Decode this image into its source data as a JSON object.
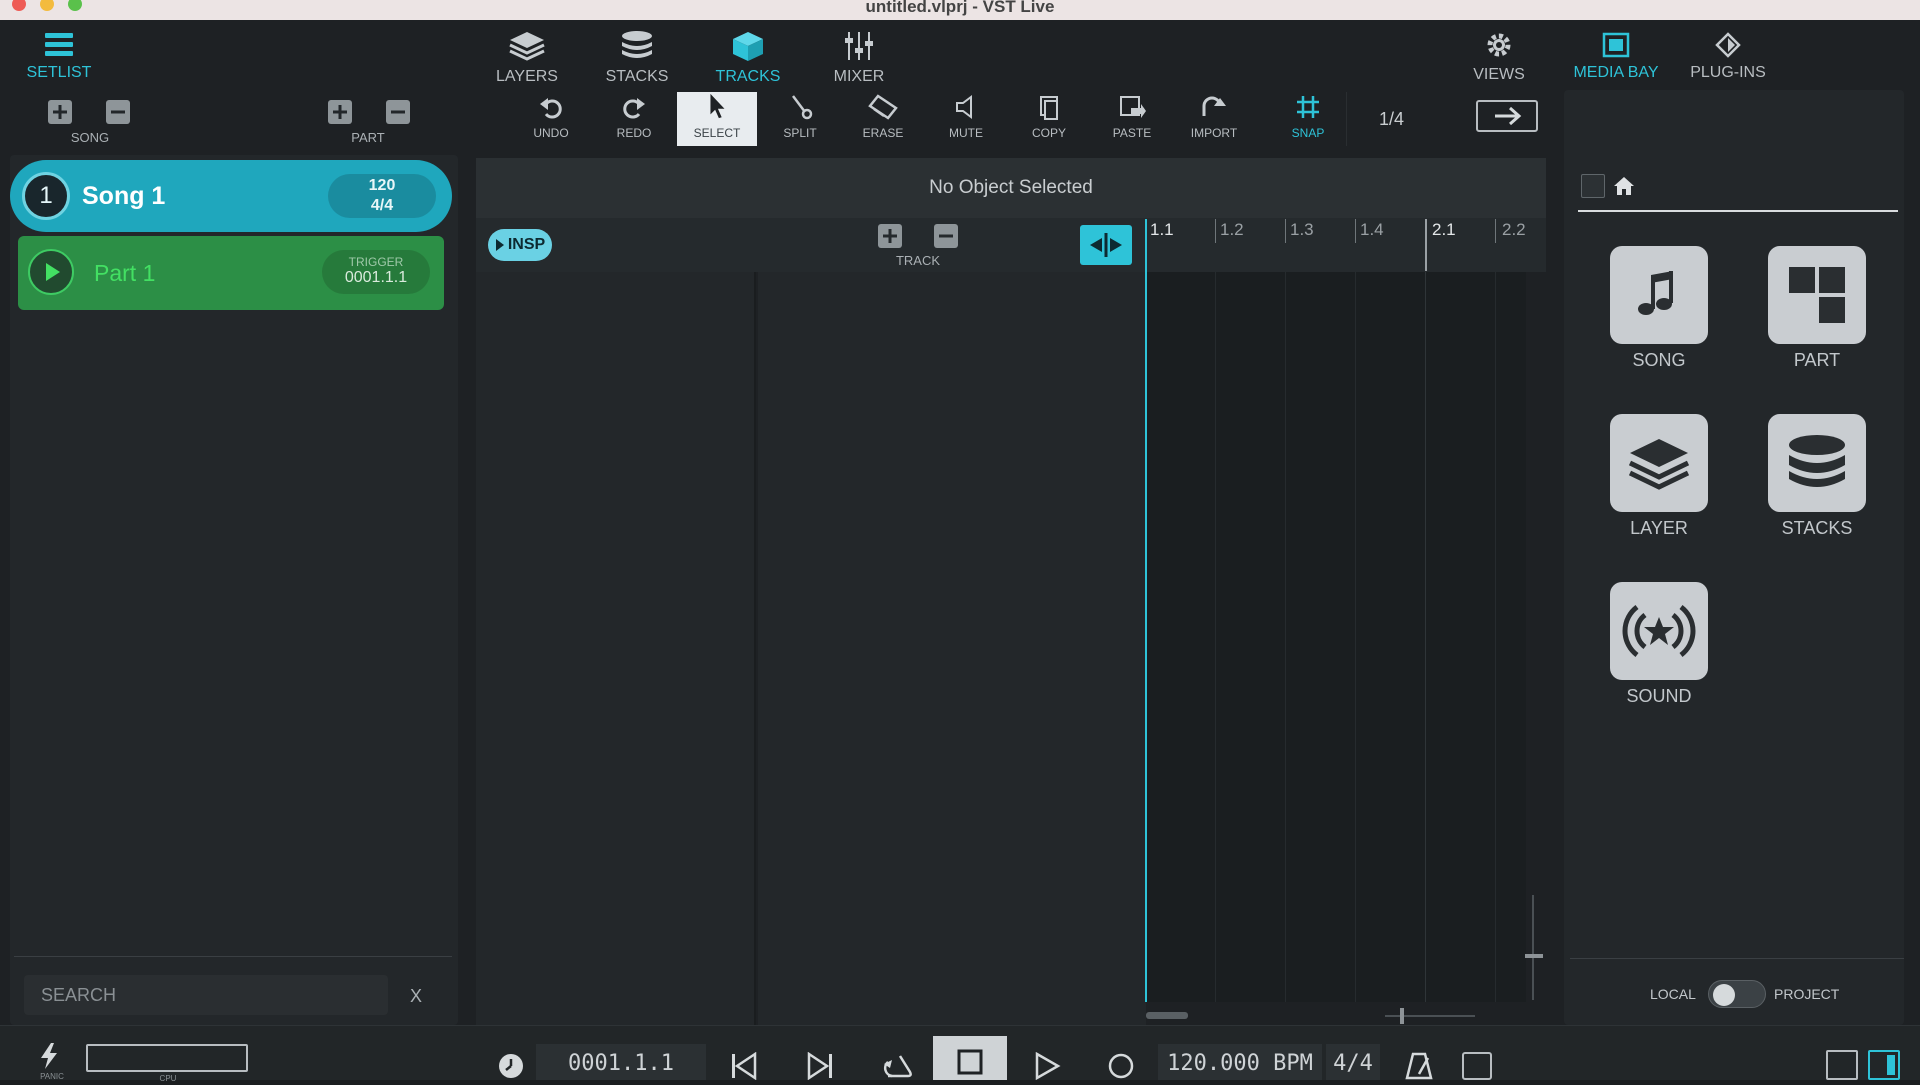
{
  "window": {
    "title": "untitled.vlprj - VST Live"
  },
  "left": {
    "setlist_label": "SETLIST",
    "song_label": "SONG",
    "part_label": "PART",
    "song": {
      "number": "1",
      "name": "Song 1",
      "tempo": "120",
      "signature": "4/4"
    },
    "part": {
      "name": "Part 1",
      "trigger_label": "TRIGGER",
      "trigger_value": "0001.1.1"
    },
    "search_placeholder": "SEARCH",
    "search_clear": "X"
  },
  "nav": {
    "layers": "LAYERS",
    "stacks": "STACKS",
    "tracks": "TRACKS",
    "mixer": "MIXER",
    "views": "VIEWS"
  },
  "tools": {
    "undo": "UNDO",
    "redo": "REDO",
    "select": "SELECT",
    "split": "SPLIT",
    "erase": "ERASE",
    "mute": "MUTE",
    "copy": "COPY",
    "paste": "PASTE",
    "import": "IMPORT",
    "snap": "SNAP",
    "snap_value": "1/4"
  },
  "inspector": {
    "status": "No Object Selected",
    "insp_label": "INSP",
    "track_label": "TRACK"
  },
  "ruler": {
    "labels": [
      "1.1",
      "1.2",
      "1.3",
      "1.4",
      "2.1",
      "2.2"
    ]
  },
  "right": {
    "media_bay": "MEDIA BAY",
    "plugins": "PLUG-INS",
    "tiles": {
      "song": "SONG",
      "part": "PART",
      "layer": "LAYER",
      "stacks": "STACKS",
      "sound": "SOUND"
    },
    "local": "LOCAL",
    "project": "PROJECT"
  },
  "transport": {
    "position": "0001.1.1",
    "tempo": "120.000 BPM",
    "signature": "4/4",
    "panic": "PANIC",
    "cpu": "CPU"
  },
  "colors": {
    "accent": "#2ec3d8",
    "song_bg": "#1fa7bd",
    "part_bg": "#2c8f46",
    "part_text": "#43e063"
  }
}
